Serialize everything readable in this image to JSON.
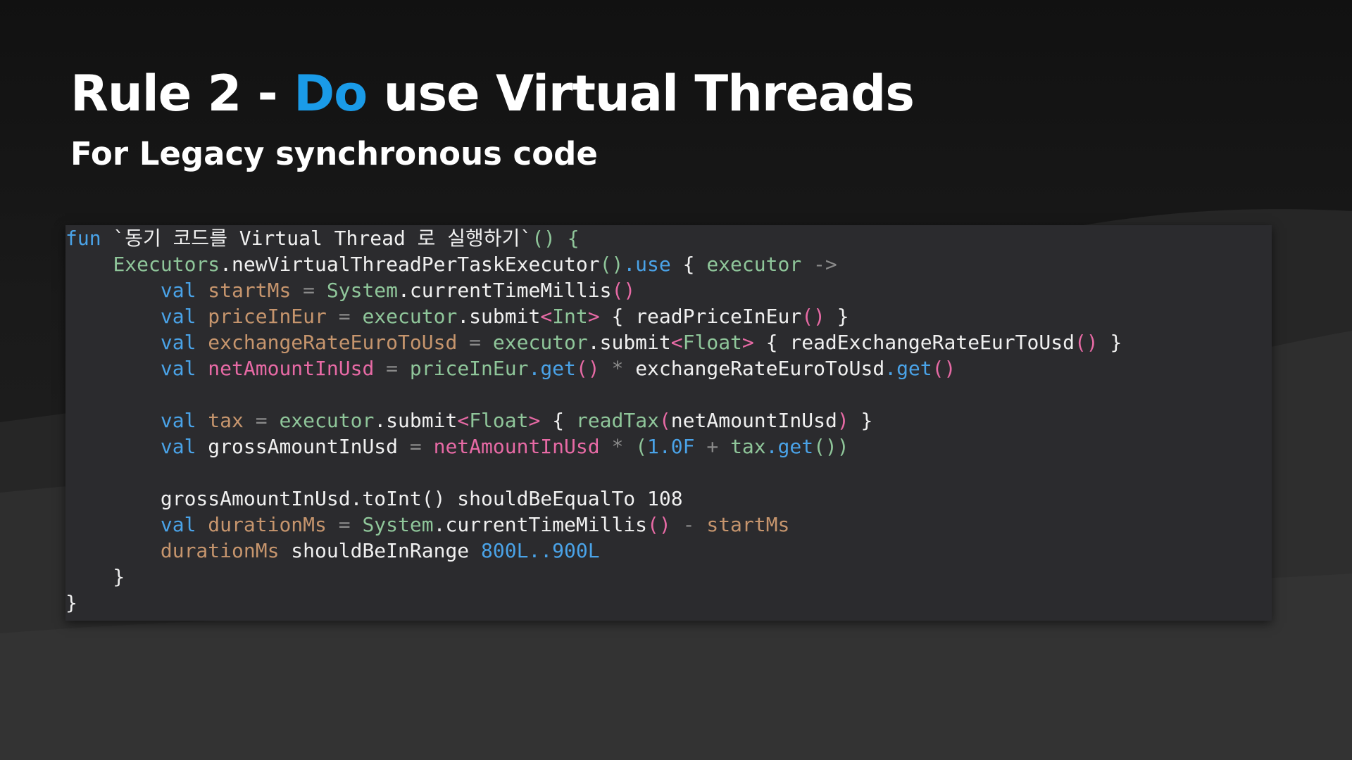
{
  "title": {
    "prefix": "Rule 2 - ",
    "accent": "Do",
    "suffix": " use Virtual Threads"
  },
  "subtitle": "For Legacy synchronous code",
  "colors": {
    "accent": "#1a9be8",
    "keyword": "#4aa3e8",
    "variable": "#c6956d",
    "identifier": "#8fc69a",
    "type_param": "#e76aa5",
    "number": "#4aa3e8",
    "code_background": "#2b2b2e",
    "page_background": "#1c1c1c"
  },
  "code": {
    "language": "kotlin",
    "lines": [
      [
        {
          "t": "fun",
          "c": "kw"
        },
        {
          "t": " `동기 코드를 Virtual Thread 로 실행하기`",
          "c": "pl"
        },
        {
          "t": "()",
          "c": "gr"
        },
        {
          "t": " {",
          "c": "gr"
        }
      ],
      [
        {
          "t": "    ",
          "c": "pl"
        },
        {
          "t": "Executors",
          "c": "gr"
        },
        {
          "t": ".newVirtualThreadPerTaskExecutor",
          "c": "pl"
        },
        {
          "t": "()",
          "c": "gr"
        },
        {
          "t": ".use",
          "c": "kw"
        },
        {
          "t": " { ",
          "c": "pl"
        },
        {
          "t": "executor",
          "c": "gr"
        },
        {
          "t": " ->",
          "c": "op"
        }
      ],
      [
        {
          "t": "        ",
          "c": "pl"
        },
        {
          "t": "val",
          "c": "kw"
        },
        {
          "t": " startMs",
          "c": "vd"
        },
        {
          "t": " = ",
          "c": "op"
        },
        {
          "t": "System",
          "c": "gr"
        },
        {
          "t": ".currentTimeMillis",
          "c": "pl"
        },
        {
          "t": "()",
          "c": "mg"
        }
      ],
      [
        {
          "t": "        ",
          "c": "pl"
        },
        {
          "t": "val",
          "c": "kw"
        },
        {
          "t": " priceInEur",
          "c": "vd"
        },
        {
          "t": " = ",
          "c": "op"
        },
        {
          "t": "executor",
          "c": "gr"
        },
        {
          "t": ".submit",
          "c": "pl"
        },
        {
          "t": "<",
          "c": "mg"
        },
        {
          "t": "Int",
          "c": "gr"
        },
        {
          "t": ">",
          "c": "mg"
        },
        {
          "t": " { readPriceInEur",
          "c": "pl"
        },
        {
          "t": "()",
          "c": "mg"
        },
        {
          "t": " }",
          "c": "pl"
        }
      ],
      [
        {
          "t": "        ",
          "c": "pl"
        },
        {
          "t": "val",
          "c": "kw"
        },
        {
          "t": " exchangeRateEuroToUsd",
          "c": "vd"
        },
        {
          "t": " = ",
          "c": "op"
        },
        {
          "t": "executor",
          "c": "gr"
        },
        {
          "t": ".submit",
          "c": "pl"
        },
        {
          "t": "<",
          "c": "mg"
        },
        {
          "t": "Float",
          "c": "gr"
        },
        {
          "t": ">",
          "c": "mg"
        },
        {
          "t": " { readExchangeRateEurToUsd",
          "c": "pl"
        },
        {
          "t": "()",
          "c": "mg"
        },
        {
          "t": " }",
          "c": "pl"
        }
      ],
      [
        {
          "t": "        ",
          "c": "pl"
        },
        {
          "t": "val",
          "c": "kw"
        },
        {
          "t": " netAmountInUsd",
          "c": "mg"
        },
        {
          "t": " = ",
          "c": "op"
        },
        {
          "t": "priceInEur",
          "c": "gr"
        },
        {
          "t": ".get",
          "c": "kw"
        },
        {
          "t": "()",
          "c": "mg"
        },
        {
          "t": " * ",
          "c": "op"
        },
        {
          "t": "exchangeRateEuroToUsd",
          "c": "pl"
        },
        {
          "t": ".get",
          "c": "kw"
        },
        {
          "t": "()",
          "c": "mg"
        }
      ],
      [],
      [
        {
          "t": "        ",
          "c": "pl"
        },
        {
          "t": "val",
          "c": "kw"
        },
        {
          "t": " tax",
          "c": "vd"
        },
        {
          "t": " = ",
          "c": "op"
        },
        {
          "t": "executor",
          "c": "gr"
        },
        {
          "t": ".submit",
          "c": "pl"
        },
        {
          "t": "<",
          "c": "mg"
        },
        {
          "t": "Float",
          "c": "gr"
        },
        {
          "t": ">",
          "c": "mg"
        },
        {
          "t": " { ",
          "c": "pl"
        },
        {
          "t": "readTax",
          "c": "gr"
        },
        {
          "t": "(",
          "c": "mg"
        },
        {
          "t": "netAmountInUsd",
          "c": "pl"
        },
        {
          "t": ")",
          "c": "mg"
        },
        {
          "t": " }",
          "c": "pl"
        }
      ],
      [
        {
          "t": "        ",
          "c": "pl"
        },
        {
          "t": "val",
          "c": "kw"
        },
        {
          "t": " grossAmountInUsd",
          "c": "pl"
        },
        {
          "t": " = ",
          "c": "op"
        },
        {
          "t": "netAmountInUsd",
          "c": "mg"
        },
        {
          "t": " * ",
          "c": "op"
        },
        {
          "t": "(",
          "c": "gr"
        },
        {
          "t": "1.0F",
          "c": "nm"
        },
        {
          "t": " + ",
          "c": "op"
        },
        {
          "t": "tax",
          "c": "gr"
        },
        {
          "t": ".get",
          "c": "kw"
        },
        {
          "t": "())",
          "c": "gr"
        }
      ],
      [],
      [
        {
          "t": "        grossAmountInUsd.toInt() shouldBeEqualTo 108",
          "c": "pl"
        }
      ],
      [
        {
          "t": "        ",
          "c": "pl"
        },
        {
          "t": "val",
          "c": "kw"
        },
        {
          "t": " durationMs",
          "c": "vd"
        },
        {
          "t": " = ",
          "c": "op"
        },
        {
          "t": "System",
          "c": "gr"
        },
        {
          "t": ".currentTimeMillis",
          "c": "pl"
        },
        {
          "t": "()",
          "c": "mg"
        },
        {
          "t": " - ",
          "c": "op"
        },
        {
          "t": "startMs",
          "c": "vd"
        }
      ],
      [
        {
          "t": "        ",
          "c": "pl"
        },
        {
          "t": "durationMs",
          "c": "vd"
        },
        {
          "t": " shouldBeInRange ",
          "c": "pl"
        },
        {
          "t": "800L..900L",
          "c": "nm"
        }
      ],
      [
        {
          "t": "    }",
          "c": "pl"
        }
      ],
      [
        {
          "t": "}",
          "c": "pl"
        }
      ]
    ]
  }
}
